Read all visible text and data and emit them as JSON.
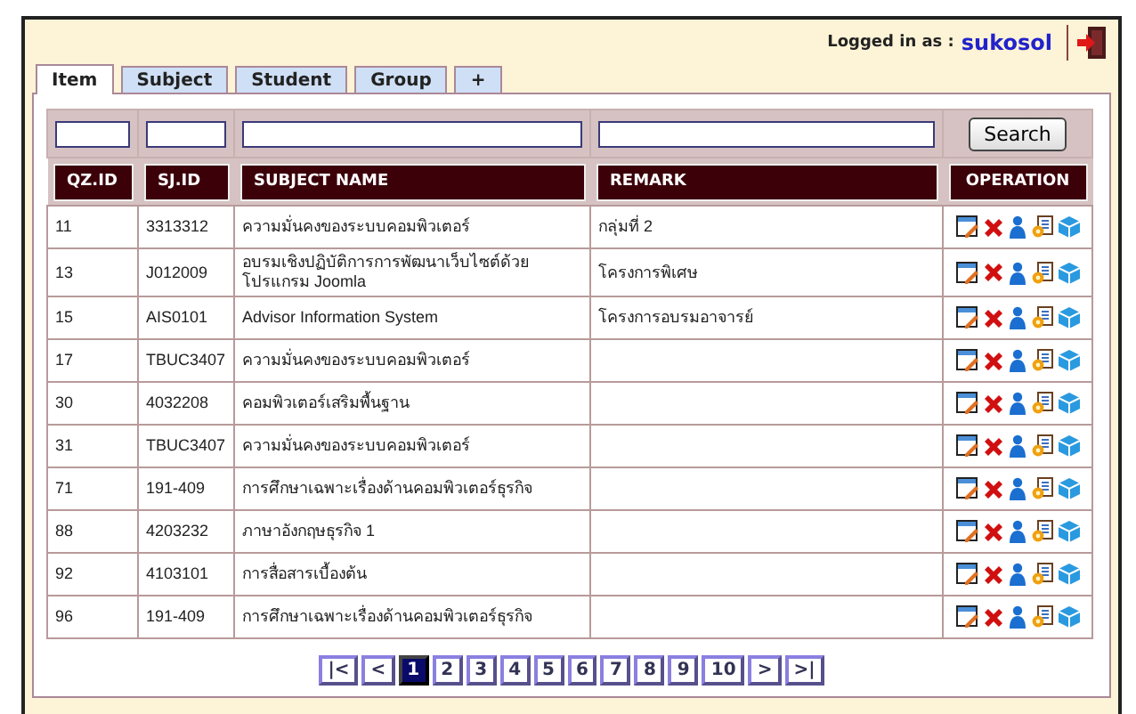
{
  "user": {
    "label": "Logged in as :",
    "name": "sukosol"
  },
  "tabs": [
    {
      "label": "Item",
      "selected": true
    },
    {
      "label": "Subject",
      "selected": false
    },
    {
      "label": "Student",
      "selected": false
    },
    {
      "label": "Group",
      "selected": false
    },
    {
      "label": "+",
      "selected": false
    }
  ],
  "filters": {
    "search_button": "Search"
  },
  "columns": [
    "QZ.ID",
    "SJ.ID",
    "SUBJECT NAME",
    "REMARK",
    "OPERATION"
  ],
  "rows": [
    {
      "qz_id": "11",
      "sj_id": "3313312",
      "subject_name": "ความมั่นคงของระบบคอมพิวเตอร์",
      "remark": "กลุ่มที่ 2"
    },
    {
      "qz_id": "13",
      "sj_id": "J012009",
      "subject_name": "อบรมเชิงปฏิบัติการการพัฒนาเว็บไซต์ด้วยโปรแกรม Joomla",
      "remark": "โครงการพิเศษ"
    },
    {
      "qz_id": "15",
      "sj_id": "AIS0101",
      "subject_name": "Advisor Information System",
      "remark": "โครงการอบรมอาจารย์"
    },
    {
      "qz_id": "17",
      "sj_id": "TBUC3407",
      "subject_name": "ความมั่นคงของระบบคอมพิวเตอร์"
    },
    {
      "qz_id": "30",
      "sj_id": "4032208",
      "subject_name": "คอมพิวเตอร์เสริมพื้นฐาน"
    },
    {
      "qz_id": "31",
      "sj_id": "TBUC3407",
      "subject_name": "ความมั่นคงของระบบคอมพิวเตอร์"
    },
    {
      "qz_id": "71",
      "sj_id": "191-409",
      "subject_name": "การศึกษาเฉพาะเรื่องด้านคอมพิวเตอร์ธุรกิจ"
    },
    {
      "qz_id": "88",
      "sj_id": "4203232",
      "subject_name": "ภาษาอังกฤษธุรกิจ 1"
    },
    {
      "qz_id": "92",
      "sj_id": "4103101",
      "subject_name": "การสื่อสารเบื้องต้น"
    },
    {
      "qz_id": "96",
      "sj_id": "191-409",
      "subject_name": "การศึกษาเฉพาะเรื่องด้านคอมพิวเตอร์ธุรกิจ"
    }
  ],
  "pagination": [
    {
      "label": "|<",
      "selected": false
    },
    {
      "label": "<",
      "selected": false
    },
    {
      "label": "1",
      "selected": true
    },
    {
      "label": "2",
      "selected": false
    },
    {
      "label": "3",
      "selected": false
    },
    {
      "label": "4",
      "selected": false
    },
    {
      "label": "5",
      "selected": false
    },
    {
      "label": "6",
      "selected": false
    },
    {
      "label": "7",
      "selected": false
    },
    {
      "label": "8",
      "selected": false
    },
    {
      "label": "9",
      "selected": false
    },
    {
      "label": "10",
      "selected": false
    },
    {
      "label": ">",
      "selected": false
    },
    {
      "label": ">|",
      "selected": false
    }
  ]
}
